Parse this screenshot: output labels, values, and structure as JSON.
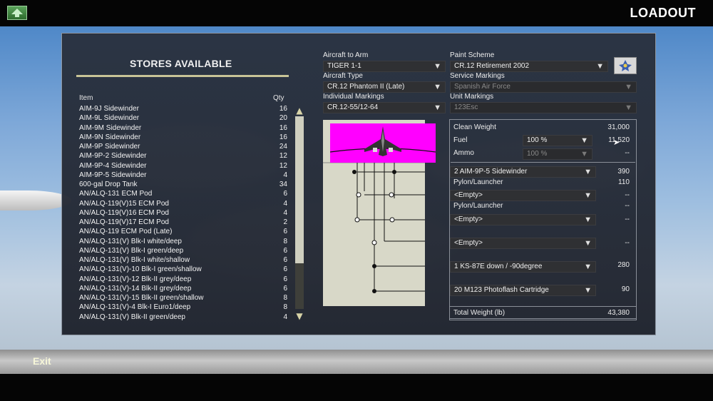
{
  "header": {
    "title": "LOADOUT",
    "home_icon": "up-arrow-icon"
  },
  "stores": {
    "title": "STORES AVAILABLE",
    "col_item": "Item",
    "col_qty": "Qty",
    "items": [
      {
        "name": "AIM-9J Sidewinder",
        "qty": "16"
      },
      {
        "name": "AIM-9L Sidewinder",
        "qty": "20"
      },
      {
        "name": "AIM-9M Sidewinder",
        "qty": "16"
      },
      {
        "name": "AIM-9N Sidewinder",
        "qty": "16"
      },
      {
        "name": "AIM-9P Sidewinder",
        "qty": "24"
      },
      {
        "name": "AIM-9P-2 Sidewinder",
        "qty": "12"
      },
      {
        "name": "AIM-9P-4 Sidewinder",
        "qty": "12"
      },
      {
        "name": "AIM-9P-5 Sidewinder",
        "qty": "4"
      },
      {
        "name": "600-gal Drop Tank",
        "qty": "34"
      },
      {
        "name": "AN/ALQ-131 ECM Pod",
        "qty": "6"
      },
      {
        "name": "AN/ALQ-119(V)15 ECM Pod",
        "qty": "4"
      },
      {
        "name": "AN/ALQ-119(V)16 ECM Pod",
        "qty": "4"
      },
      {
        "name": "AN/ALQ-119(V)17 ECM Pod",
        "qty": "2"
      },
      {
        "name": "AN/ALQ-119 ECM Pod (Late)",
        "qty": "6"
      },
      {
        "name": "AN/ALQ-131(V) Blk-I white/deep",
        "qty": "8"
      },
      {
        "name": "AN/ALQ-131(V) Blk-I green/deep",
        "qty": "6"
      },
      {
        "name": "AN/ALQ-131(V) Blk-I white/shallow",
        "qty": "6"
      },
      {
        "name": "AN/ALQ-131(V)-10 Blk-I green/shallow",
        "qty": "6"
      },
      {
        "name": "AN/ALQ-131(V)-12 Blk-II grey/deep",
        "qty": "6"
      },
      {
        "name": "AN/ALQ-131(V)-14 Blk-II grey/deep",
        "qty": "6"
      },
      {
        "name": "AN/ALQ-131(V)-15 Blk-II green/shallow",
        "qty": "8"
      },
      {
        "name": "AN/ALQ-131(V)-4 Blk-I Euro1/deep",
        "qty": "8"
      },
      {
        "name": "AN/ALQ-131(V) Blk-II green/deep",
        "qty": "4"
      }
    ]
  },
  "aircraft": {
    "arm_label": "Aircraft to Arm",
    "arm_value": "TIGER 1-1",
    "type_label": "Aircraft Type",
    "type_value": "CR.12 Phantom II (Late)",
    "markings_label": "Individual Markings",
    "markings_value": "CR.12-55/12-64"
  },
  "paint": {
    "scheme_label": "Paint Scheme",
    "scheme_value": "CR.12 Retirement 2002",
    "service_label": "Service Markings",
    "service_value": "Spanish Air Force",
    "unit_label": "Unit Markings",
    "unit_value": "123Esc"
  },
  "weights": {
    "clean_label": "Clean Weight",
    "clean_value": "31,000",
    "fuel_label": "Fuel",
    "fuel_pct": "100 %",
    "fuel_value": "11,520",
    "ammo_label": "Ammo",
    "ammo_pct": "100 %",
    "ammo_value": "--",
    "total_label": "Total Weight (lb)",
    "total_value": "43,380"
  },
  "stations": [
    {
      "store": "2 AIM-9P-5 Sidewinder",
      "weight": "390",
      "sub_label": "Pylon/Launcher",
      "sub_weight": "110"
    },
    {
      "store": "<Empty>",
      "weight": "--",
      "sub_label": "Pylon/Launcher",
      "sub_weight": "--"
    },
    {
      "store": "<Empty>",
      "weight": "--"
    },
    {
      "store": "<Empty>",
      "weight": "--"
    },
    {
      "store": "1 KS-87E down / -90degree",
      "weight": "280"
    },
    {
      "store": "20 M123 Photoflash Cartridge",
      "weight": "90"
    }
  ],
  "footer": {
    "exit_label": "Exit"
  },
  "colors": {
    "accent_rule": "#c8c497",
    "plane_bg": "#ff00ff",
    "panel_bg": "#2a2f3a"
  }
}
